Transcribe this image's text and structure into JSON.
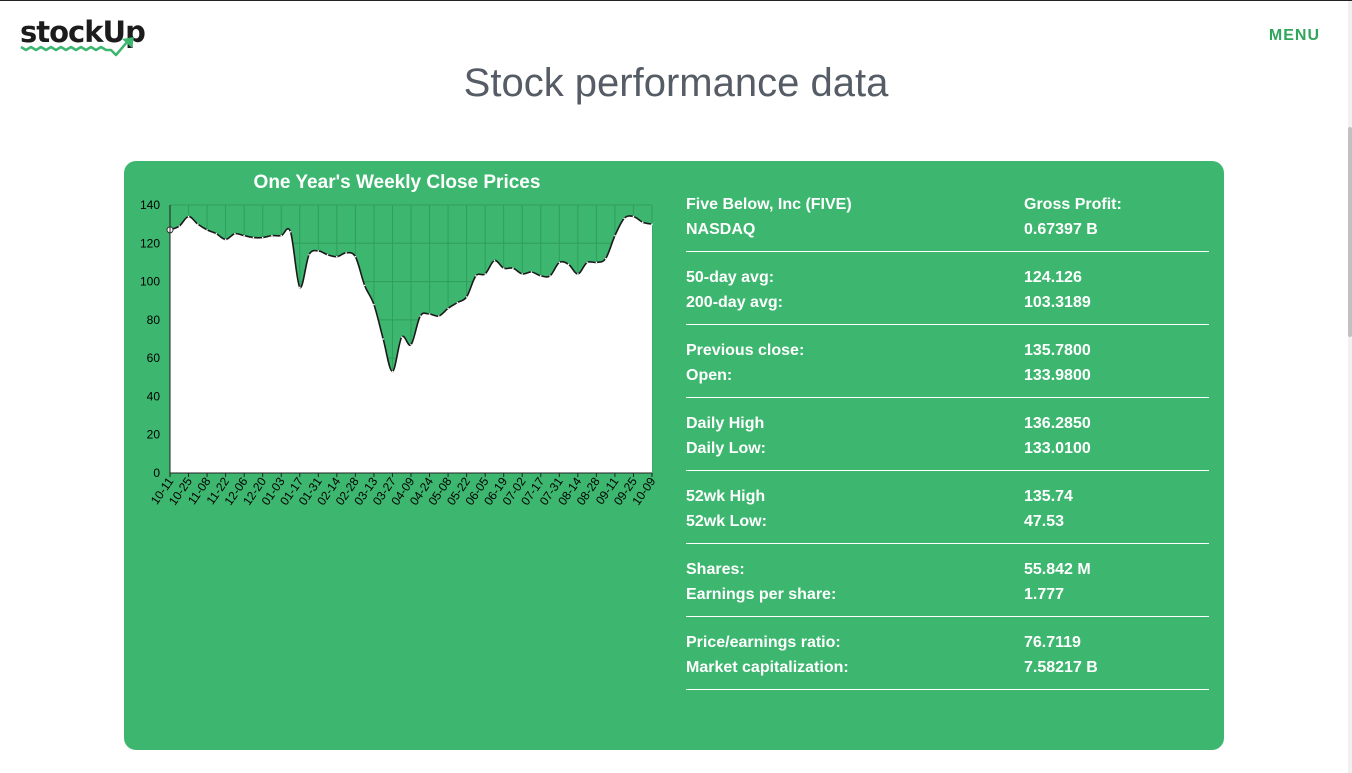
{
  "header": {
    "logo_text": "stockUp",
    "menu_label": "MENU"
  },
  "page": {
    "title": "Stock performance data"
  },
  "stats": {
    "groups": [
      {
        "rows": [
          {
            "label": "Five Below, Inc (FIVE)",
            "value": "Gross Profit:"
          },
          {
            "label": "NASDAQ",
            "value": "0.67397 B"
          }
        ]
      },
      {
        "rows": [
          {
            "label": "50-day avg:",
            "value": "124.126"
          },
          {
            "label": "200-day avg:",
            "value": "103.3189"
          }
        ]
      },
      {
        "rows": [
          {
            "label": "Previous close:",
            "value": "135.7800"
          },
          {
            "label": "Open:",
            "value": "133.9800"
          }
        ]
      },
      {
        "rows": [
          {
            "label": "Daily High",
            "value": "136.2850"
          },
          {
            "label": "Daily Low:",
            "value": "133.0100"
          }
        ]
      },
      {
        "rows": [
          {
            "label": "52wk High",
            "value": "135.74"
          },
          {
            "label": "52wk Low:",
            "value": "47.53"
          }
        ]
      },
      {
        "rows": [
          {
            "label": "Shares:",
            "value": "55.842 M"
          },
          {
            "label": "Earnings per share:",
            "value": "1.777"
          }
        ]
      },
      {
        "rows": [
          {
            "label": "Price/earnings ratio:",
            "value": "76.7119"
          },
          {
            "label": "Market capitalization:",
            "value": "7.58217 B"
          }
        ]
      }
    ]
  },
  "chart_data": {
    "type": "line",
    "title": "One Year's Weekly Close Prices",
    "xlabel": "",
    "ylabel": "",
    "ylim": [
      0,
      140
    ],
    "yticks": [
      0,
      20,
      40,
      60,
      80,
      100,
      120,
      140
    ],
    "xtick_labels": [
      "10-11",
      "10-25",
      "11-08",
      "11-22",
      "12-06",
      "12-20",
      "01-03",
      "01-17",
      "01-31",
      "02-14",
      "02-28",
      "03-13",
      "03-27",
      "04-09",
      "04-24",
      "05-08",
      "05-22",
      "06-05",
      "06-19",
      "07-02",
      "07-17",
      "07-31",
      "08-14",
      "08-28",
      "09-11",
      "09-25",
      "10-09"
    ],
    "x": [
      0,
      0.5,
      1,
      1.5,
      2,
      2.5,
      3,
      3.5,
      4,
      4.5,
      5,
      5.5,
      6,
      6.5,
      7,
      7.5,
      8,
      8.5,
      9,
      9.5,
      10,
      10.5,
      11,
      11.5,
      12,
      12.5,
      13,
      13.5,
      14,
      14.5,
      15,
      15.5,
      16,
      16.5,
      17,
      17.5,
      18,
      18.5,
      19,
      19.5,
      20,
      20.5,
      21,
      21.5,
      22,
      22.5,
      23,
      23.5,
      24,
      24.5,
      25,
      25.5,
      26
    ],
    "values": [
      127,
      129,
      134,
      130,
      127,
      125,
      122,
      125,
      124,
      123,
      123,
      124,
      124,
      126,
      97,
      114,
      116,
      114,
      113,
      115,
      113,
      98,
      88,
      70,
      53,
      71,
      67,
      82,
      83,
      82,
      86,
      89,
      92,
      103,
      104,
      111,
      107,
      107,
      104,
      105,
      103,
      103,
      110,
      109,
      104,
      110,
      110,
      112,
      124,
      133,
      134,
      131,
      130
    ],
    "grid": true,
    "legend": "none",
    "colors": {
      "line": "#1a1a1a",
      "fill": "#3db76f",
      "plot_bg": "#ffffff",
      "grid": "#2f9d5c"
    }
  }
}
